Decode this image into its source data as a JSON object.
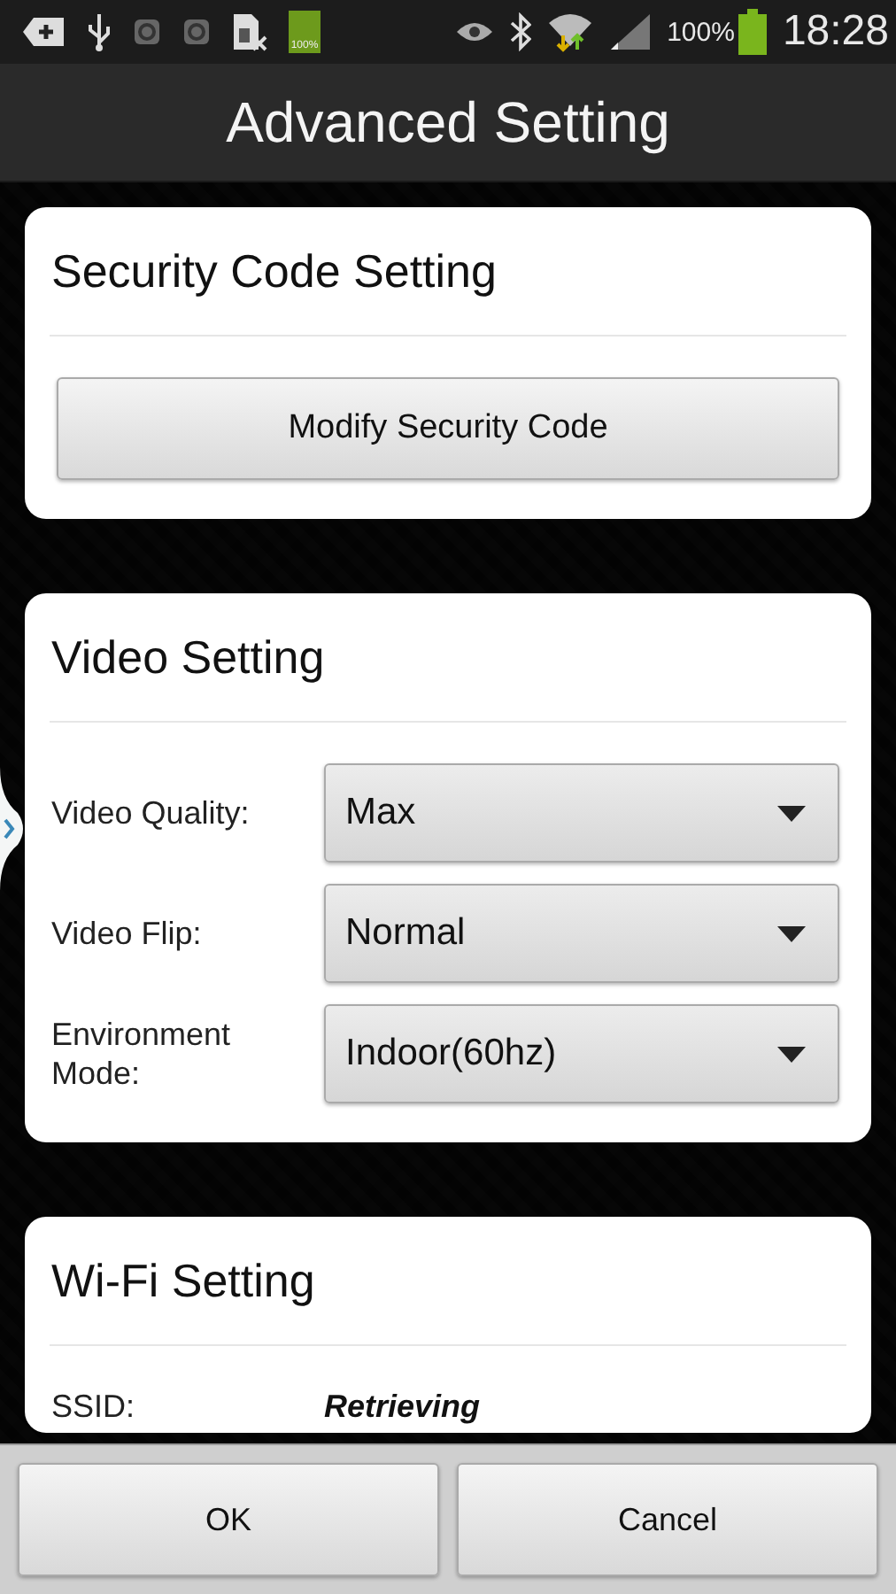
{
  "status_bar": {
    "battery_badge": "100%",
    "signal_percent": "100%",
    "time": "18:28"
  },
  "title": "Advanced Setting",
  "sections": [
    {
      "title": "Security Code Setting",
      "rows": [
        {
          "kind": "button",
          "label": "Modify Security Code"
        }
      ]
    },
    {
      "title": "Video Setting",
      "rows": [
        {
          "kind": "dropdown",
          "label": "Video Quality:",
          "value": "Max"
        },
        {
          "kind": "dropdown",
          "label": "Video Flip:",
          "value": "Normal"
        },
        {
          "kind": "dropdown",
          "label": "Environment Mode:",
          "value": "Indoor(60hz)"
        }
      ]
    },
    {
      "title": "Wi-Fi Setting",
      "rows": [
        {
          "kind": "info",
          "label": "SSID:",
          "value": "Retrieving"
        }
      ]
    }
  ],
  "buttons": [
    "OK",
    "Cancel"
  ]
}
